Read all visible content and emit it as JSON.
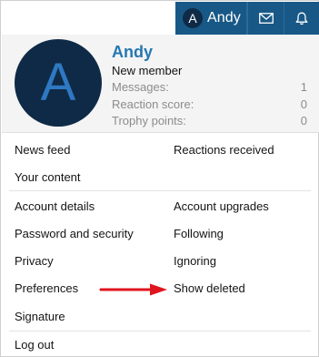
{
  "user": {
    "initial": "A",
    "name": "Andy",
    "title": "New member",
    "stats": [
      {
        "label": "Messages:",
        "value": "1"
      },
      {
        "label": "Reaction score:",
        "value": "0"
      },
      {
        "label": "Trophy points:",
        "value": "0"
      }
    ]
  },
  "menu": {
    "news_feed": "News feed",
    "reactions_received": "Reactions received",
    "your_content": "Your content",
    "account_details": "Account details",
    "account_upgrades": "Account upgrades",
    "password_security": "Password and security",
    "following": "Following",
    "privacy": "Privacy",
    "ignoring": "Ignoring",
    "preferences": "Preferences",
    "show_deleted": "Show deleted",
    "signature": "Signature",
    "log_out": "Log out"
  },
  "colors": {
    "nav_bg": "#185886",
    "avatar_bg": "#0f2a47",
    "link": "#2577b1",
    "arrow": "#e0141e"
  },
  "icons": {
    "inbox": "envelope-icon",
    "alerts": "bell-icon"
  }
}
